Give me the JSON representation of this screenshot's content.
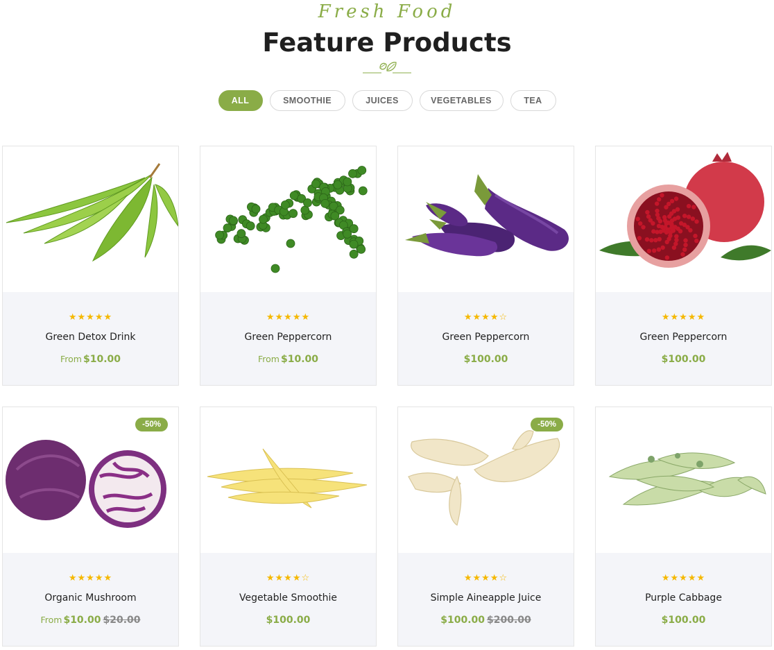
{
  "section": {
    "script_title": "Fresh Food",
    "title": "Feature Products"
  },
  "filters": [
    "ALL",
    "SMOOTHIE",
    "JUICES",
    "VEGETABLES",
    "TEA"
  ],
  "active_filter": "ALL",
  "accent_color": "#8aac47",
  "star_color": "#f5b800",
  "products": [
    {
      "name": "Green Detox Drink",
      "rating": 5,
      "from": "From",
      "price": "$10.00",
      "old_price": "",
      "badge": "",
      "image": "green-beans"
    },
    {
      "name": "Green Peppercorn",
      "rating": 5,
      "from": "From",
      "price": "$10.00",
      "old_price": "",
      "badge": "",
      "image": "peppercorn"
    },
    {
      "name": "Green Peppercorn",
      "rating": 4,
      "from": "",
      "price": "$100.00",
      "old_price": "",
      "badge": "",
      "image": "eggplant"
    },
    {
      "name": "Green Peppercorn",
      "rating": 5,
      "from": "",
      "price": "$100.00",
      "old_price": "",
      "badge": "",
      "image": "pomegranate"
    },
    {
      "name": "Organic Mushroom",
      "rating": 5,
      "from": "From",
      "price": "$10.00",
      "old_price": "$20.00",
      "badge": "-50%",
      "image": "purple-cabbage"
    },
    {
      "name": "Vegetable Smoothie",
      "rating": 4,
      "from": "",
      "price": "$100.00",
      "old_price": "",
      "badge": "",
      "image": "baby-corn"
    },
    {
      "name": "Simple Aineapple Juice",
      "rating": 4,
      "from": "",
      "price": "$100.00",
      "old_price": "$200.00",
      "badge": "-50%",
      "image": "ginger"
    },
    {
      "name": "Purple Cabbage",
      "rating": 5,
      "from": "",
      "price": "$100.00",
      "old_price": "",
      "badge": "",
      "image": "green-chilies"
    }
  ]
}
